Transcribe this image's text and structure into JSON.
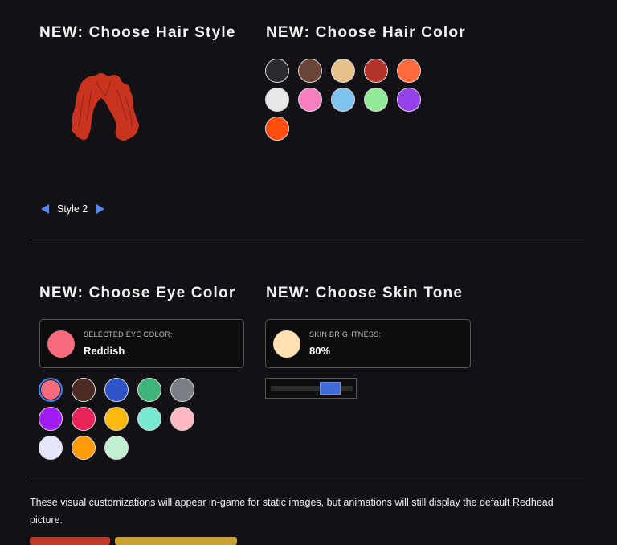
{
  "hair_style": {
    "heading": "NEW: Choose Hair Style",
    "current_style": "Style 2",
    "hair_color": "#c8341f"
  },
  "hair_color": {
    "heading": "NEW: Choose Hair Color",
    "swatches": [
      "#2c2a2e",
      "#6b4438",
      "#e8c08a",
      "#b33328",
      "#ff6b3d",
      "#e8e8ea",
      "#f57fc0",
      "#7fc3ee",
      "#93e99a",
      "#9540e8",
      "#ff4d0d"
    ]
  },
  "eye_color": {
    "heading": "NEW: Choose Eye Color",
    "selected_label": "SELECTED EYE COLOR:",
    "selected_value": "Reddish",
    "selected_color": "#f76c7c",
    "swatches": [
      "#f76c7c",
      "#4a2a23",
      "#2d55c9",
      "#3fb57a",
      "#7a7e85",
      "#a11cf2",
      "#e8235a",
      "#ffb80b",
      "#79e8d2",
      "#ffb8c0",
      "#e6e6fa",
      "#ff9a0a",
      "#c0f0cf"
    ]
  },
  "skin_tone": {
    "heading": "NEW: Choose Skin Tone",
    "brightness_label": "SKIN BRIGHTNESS:",
    "brightness_value": "80%",
    "brightness": 0.8,
    "selected_color": "#ffe2b3"
  },
  "footer_note": "These visual customizations will appear in-game for static images, but animations will still display the default Redhead picture."
}
